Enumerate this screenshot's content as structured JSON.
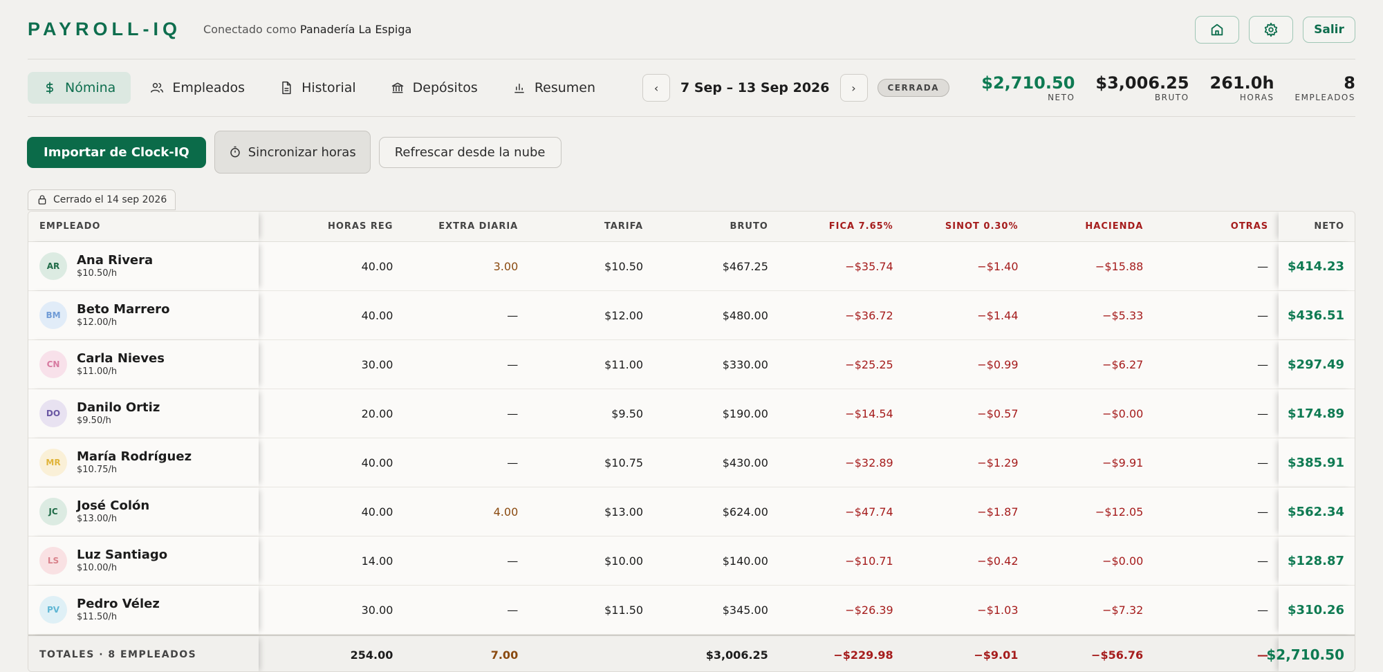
{
  "header": {
    "logo": "PAYROLL-IQ",
    "connected_prefix": "Conectado como",
    "company": "Panadería La Espiga",
    "exit_label": "Salir"
  },
  "nav": {
    "tabs": [
      {
        "label": "Nómina",
        "icon": "dollar-icon"
      },
      {
        "label": "Empleados",
        "icon": "users-icon"
      },
      {
        "label": "Historial",
        "icon": "document-icon"
      },
      {
        "label": "Depósitos",
        "icon": "bank-icon"
      },
      {
        "label": "Resumen",
        "icon": "chart-icon"
      }
    ],
    "period": "7 Sep – 13 Sep 2026",
    "status": "CERRADA"
  },
  "stats": [
    {
      "value": "$2,710.50",
      "label": "NETO"
    },
    {
      "value": "$3,006.25",
      "label": "BRUTO"
    },
    {
      "value": "261.0h",
      "label": "HORAS"
    },
    {
      "value": "8",
      "label": "EMPLEADOS"
    }
  ],
  "actions": {
    "import": "Importar de Clock-IQ",
    "sync": "Sincronizar horas",
    "refresh": "Refrescar desde la nube"
  },
  "closed_note": "Cerrado el 14 sep 2026",
  "table": {
    "headers": [
      "EMPLEADO",
      "HORAS REG",
      "EXTRA DIARIA",
      "TARIFA",
      "BRUTO",
      "FICA 7.65%",
      "SINOT 0.30%",
      "HACIENDA",
      "OTRAS",
      "NETO"
    ],
    "rows": [
      {
        "initials": "AR",
        "name": "Ana Rivera",
        "rate": "$10.50/h",
        "hours": "40.00",
        "extra": "3.00",
        "tarifa": "$10.50",
        "bruto": "$467.25",
        "fica": "−$35.74",
        "sinot": "−$1.40",
        "hacienda": "−$15.88",
        "otras": "—",
        "neto": "$414.23",
        "avatar_bg": "#dcebe2",
        "avatar_fg": "#1f6b47"
      },
      {
        "initials": "BM",
        "name": "Beto Marrero",
        "rate": "$12.00/h",
        "hours": "40.00",
        "extra": "—",
        "tarifa": "$12.00",
        "bruto": "$480.00",
        "fica": "−$36.72",
        "sinot": "−$1.44",
        "hacienda": "−$5.33",
        "otras": "—",
        "neto": "$436.51",
        "avatar_bg": "#e1ecf8",
        "avatar_fg": "#6f9bd6"
      },
      {
        "initials": "CN",
        "name": "Carla Nieves",
        "rate": "$11.00/h",
        "hours": "30.00",
        "extra": "—",
        "tarifa": "$11.00",
        "bruto": "$330.00",
        "fica": "−$25.25",
        "sinot": "−$0.99",
        "hacienda": "−$6.27",
        "otras": "—",
        "neto": "$297.49",
        "avatar_bg": "#f8e1ea",
        "avatar_fg": "#d77aa0"
      },
      {
        "initials": "DO",
        "name": "Danilo Ortiz",
        "rate": "$9.50/h",
        "hours": "20.00",
        "extra": "—",
        "tarifa": "$9.50",
        "bruto": "$190.00",
        "fica": "−$14.54",
        "sinot": "−$0.57",
        "hacienda": "−$0.00",
        "otras": "—",
        "neto": "$174.89",
        "avatar_bg": "#e8e2f1",
        "avatar_fg": "#6a57a3"
      },
      {
        "initials": "MR",
        "name": "María Rodríguez",
        "rate": "$10.75/h",
        "hours": "40.00",
        "extra": "—",
        "tarifa": "$10.75",
        "bruto": "$430.00",
        "fica": "−$32.89",
        "sinot": "−$1.29",
        "hacienda": "−$9.91",
        "otras": "—",
        "neto": "$385.91",
        "avatar_bg": "#faf0d7",
        "avatar_fg": "#e0b43a"
      },
      {
        "initials": "JC",
        "name": "José Colón",
        "rate": "$13.00/h",
        "hours": "40.00",
        "extra": "4.00",
        "tarifa": "$13.00",
        "bruto": "$624.00",
        "fica": "−$47.74",
        "sinot": "−$1.87",
        "hacienda": "−$12.05",
        "otras": "—",
        "neto": "$562.34",
        "avatar_bg": "#dcebe2",
        "avatar_fg": "#1f6b47"
      },
      {
        "initials": "LS",
        "name": "Luz Santiago",
        "rate": "$10.00/h",
        "hours": "14.00",
        "extra": "—",
        "tarifa": "$10.00",
        "bruto": "$140.00",
        "fica": "−$10.71",
        "sinot": "−$0.42",
        "hacienda": "−$0.00",
        "otras": "—",
        "neto": "$128.87",
        "avatar_bg": "#f9e1e3",
        "avatar_fg": "#d9828b"
      },
      {
        "initials": "PV",
        "name": "Pedro Vélez",
        "rate": "$11.50/h",
        "hours": "30.00",
        "extra": "—",
        "tarifa": "$11.50",
        "bruto": "$345.00",
        "fica": "−$26.39",
        "sinot": "−$1.03",
        "hacienda": "−$7.32",
        "otras": "—",
        "neto": "$310.26",
        "avatar_bg": "#dff0f6",
        "avatar_fg": "#5fb6d4"
      }
    ],
    "totals": {
      "label": "TOTALES · 8 EMPLEADOS",
      "hours": "254.00",
      "extra": "7.00",
      "tarifa": "",
      "bruto": "$3,006.25",
      "fica": "−$229.98",
      "sinot": "−$9.01",
      "hacienda": "−$56.76",
      "otras": "—",
      "neto": "$2,710.50"
    }
  },
  "colors": {
    "brand": "#0e6e4e",
    "net_green": "#0e7a52",
    "deduction_red": "#a51c1c",
    "extra_brown": "#8a4a10"
  }
}
